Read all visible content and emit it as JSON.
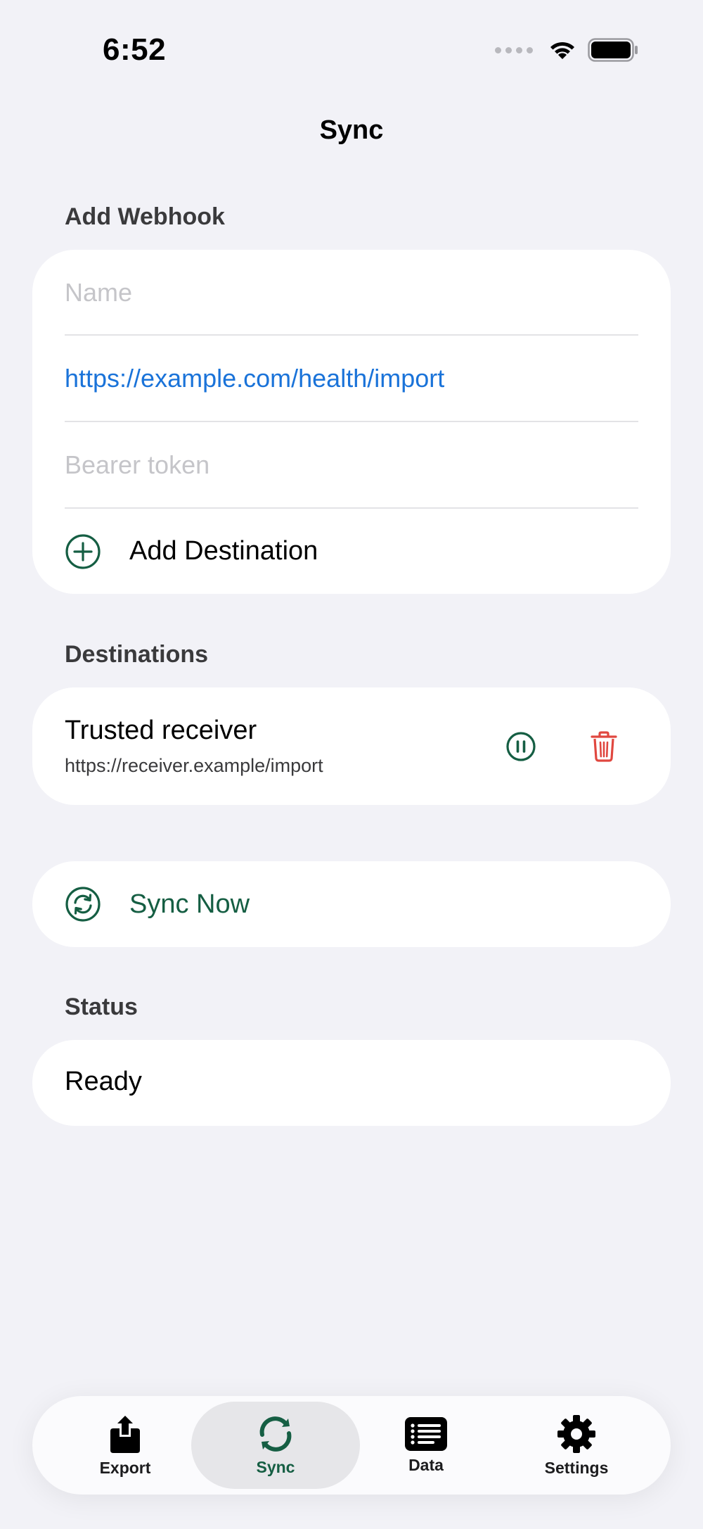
{
  "status_bar": {
    "time": "6:52"
  },
  "nav": {
    "title": "Sync"
  },
  "add_webhook": {
    "header": "Add Webhook",
    "name_placeholder": "Name",
    "url_value": "https://example.com/health/import",
    "token_placeholder": "Bearer token",
    "add_destination_label": "Add Destination"
  },
  "destinations": {
    "header": "Destinations",
    "items": [
      {
        "name": "Trusted receiver",
        "url": "https://receiver.example/import"
      }
    ]
  },
  "sync": {
    "sync_now_label": "Sync Now"
  },
  "status": {
    "header": "Status",
    "value": "Ready"
  },
  "tab_bar": {
    "tabs": [
      {
        "label": "Export",
        "icon": "share-icon"
      },
      {
        "label": "Sync",
        "icon": "sync-icon",
        "active": true
      },
      {
        "label": "Data",
        "icon": "list-icon"
      },
      {
        "label": "Settings",
        "icon": "gear-icon"
      }
    ]
  },
  "colors": {
    "accent": "#155e43",
    "link": "#1a73d9",
    "destructive": "#e0473f",
    "background": "#f2f2f7"
  }
}
